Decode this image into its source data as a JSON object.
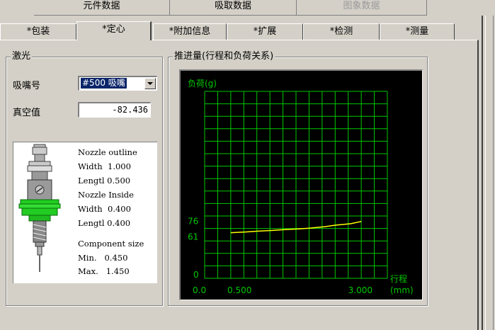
{
  "top_tabs": [
    {
      "label": "元件数据",
      "state": "active"
    },
    {
      "label": "吸取数据",
      "state": "normal"
    },
    {
      "label": "图象数据",
      "state": "disabled"
    }
  ],
  "sub_tabs": [
    {
      "label": "*包装"
    },
    {
      "label": "*定心",
      "active": true
    },
    {
      "label": "*附加信息"
    },
    {
      "label": "*扩展"
    },
    {
      "label": "*检测"
    },
    {
      "label": "*测量"
    }
  ],
  "laser_group": {
    "title": "激光",
    "nozzle_label": "吸嘴号",
    "nozzle_value": "#500 吸嘴",
    "vacuum_label": "真空值",
    "vacuum_value": "-82.436"
  },
  "nozzle_info": {
    "outline_title": "Nozzle outline",
    "outline_width": "Width  1.000",
    "outline_length": "Lengtl 0.500",
    "inside_title": "Nozzle Inside",
    "inside_width": "Width  0.400",
    "inside_length": "Lengtl 0.400",
    "component_title": "Component size",
    "component_min": "Min.   0.450",
    "component_max": "Max.   1.450"
  },
  "chart_group": {
    "title": "推进量(行程和负荷关系)"
  },
  "colors": {
    "chart_bg": "#000000",
    "grid": "#00c800",
    "axis_text": "#00c800",
    "series": "#ffff00",
    "window_bg": "#d4d0c8",
    "selection": "#0a246a",
    "nozzle_green": "#22cc22"
  },
  "chart_data": {
    "type": "line",
    "ylabel": "负荷(g)",
    "xlabel": "行程",
    "xunit": "(mm)",
    "y_ticks": [
      "76",
      "61",
      "0"
    ],
    "x_ticks": [
      "0.0",
      "0.500",
      "3.000"
    ],
    "xlim": [
      0.0,
      3.5
    ],
    "ylim": [
      0,
      250
    ],
    "grid": true,
    "grid_cols": 14,
    "grid_rows": 15,
    "series": [
      {
        "x": [
          0.5,
          0.8,
          1.0,
          1.3,
          1.5,
          1.8,
          2.0,
          2.3,
          2.5,
          2.8,
          3.0
        ],
        "y": [
          61,
          62,
          63,
          64,
          65,
          66,
          67,
          69,
          71,
          73,
          76
        ]
      }
    ]
  }
}
